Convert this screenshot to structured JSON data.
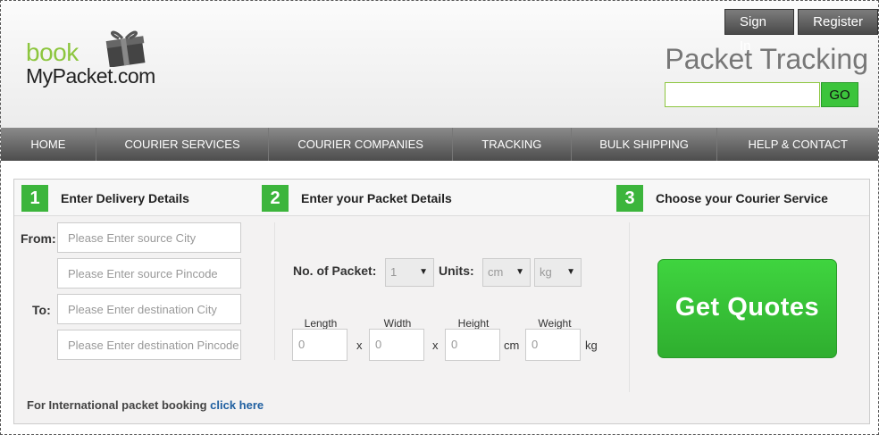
{
  "header": {
    "logo_book": "book",
    "logo_mypacket": "MyPacket.com",
    "sign_in": "Sign In",
    "register": "Register",
    "title": "Packet Tracking",
    "track_value": "",
    "go": "GO"
  },
  "nav": [
    "HOME",
    "COURIER SERVICES",
    "COURIER COMPANIES",
    "TRACKING",
    "BULK SHIPPING",
    "HELP & CONTACT"
  ],
  "steps": [
    {
      "num": "1",
      "label": "Enter Delivery Details"
    },
    {
      "num": "2",
      "label": "Enter your Packet Details"
    },
    {
      "num": "3",
      "label": "Choose your Courier Service"
    }
  ],
  "delivery": {
    "from_label": "From:",
    "to_label": "To:",
    "source_city_placeholder": "Please Enter source City",
    "source_pincode_placeholder": "Please Enter source Pincode",
    "dest_city_placeholder": "Please Enter destination City",
    "dest_pincode_placeholder": "Please Enter destination Pincode"
  },
  "packet": {
    "count_label": "No. of Packet:",
    "count_value": "1",
    "units_label": "Units:",
    "length_unit": "cm",
    "weight_unit": "kg",
    "length_label": "Length",
    "width_label": "Width",
    "height_label": "Height",
    "weight_label": "Weight",
    "length_value": "0",
    "width_value": "0",
    "height_value": "0",
    "weight_value": "0",
    "x": "x",
    "cm": "cm",
    "kg": "kg"
  },
  "quote_button": "Get Quotes",
  "international": {
    "text": "For International packet booking",
    "link": "click here"
  },
  "colors": {
    "green": "#3cb53c",
    "logo_green": "#8dc63f",
    "nav": "#5a5a5a",
    "link": "#1f5fa0"
  }
}
